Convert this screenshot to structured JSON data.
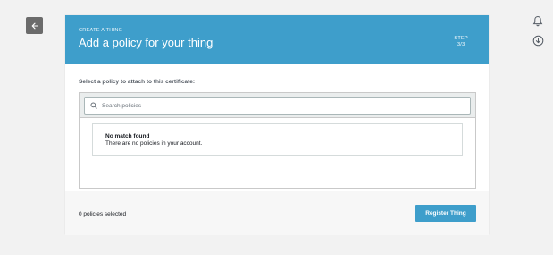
{
  "nav": {
    "back_icon": "arrow-left-icon"
  },
  "top_icons": {
    "notifications_icon": "bell-icon",
    "download_icon": "download-circle-icon"
  },
  "header": {
    "overline": "CREATE A THING",
    "title": "Add a policy for your thing",
    "step_label": "STEP",
    "step_value": "3/3",
    "background_color": "#3e9ecb"
  },
  "policy_section": {
    "prompt": "Select a policy to attach to this certificate:",
    "search": {
      "placeholder": "Search policies",
      "value": ""
    },
    "empty_state": {
      "title": "No match found",
      "description": "There are no policies in your account."
    }
  },
  "footer": {
    "selected_count": "0 policies selected",
    "register_button_label": "Register Thing",
    "button_color": "#3e9ecb"
  }
}
